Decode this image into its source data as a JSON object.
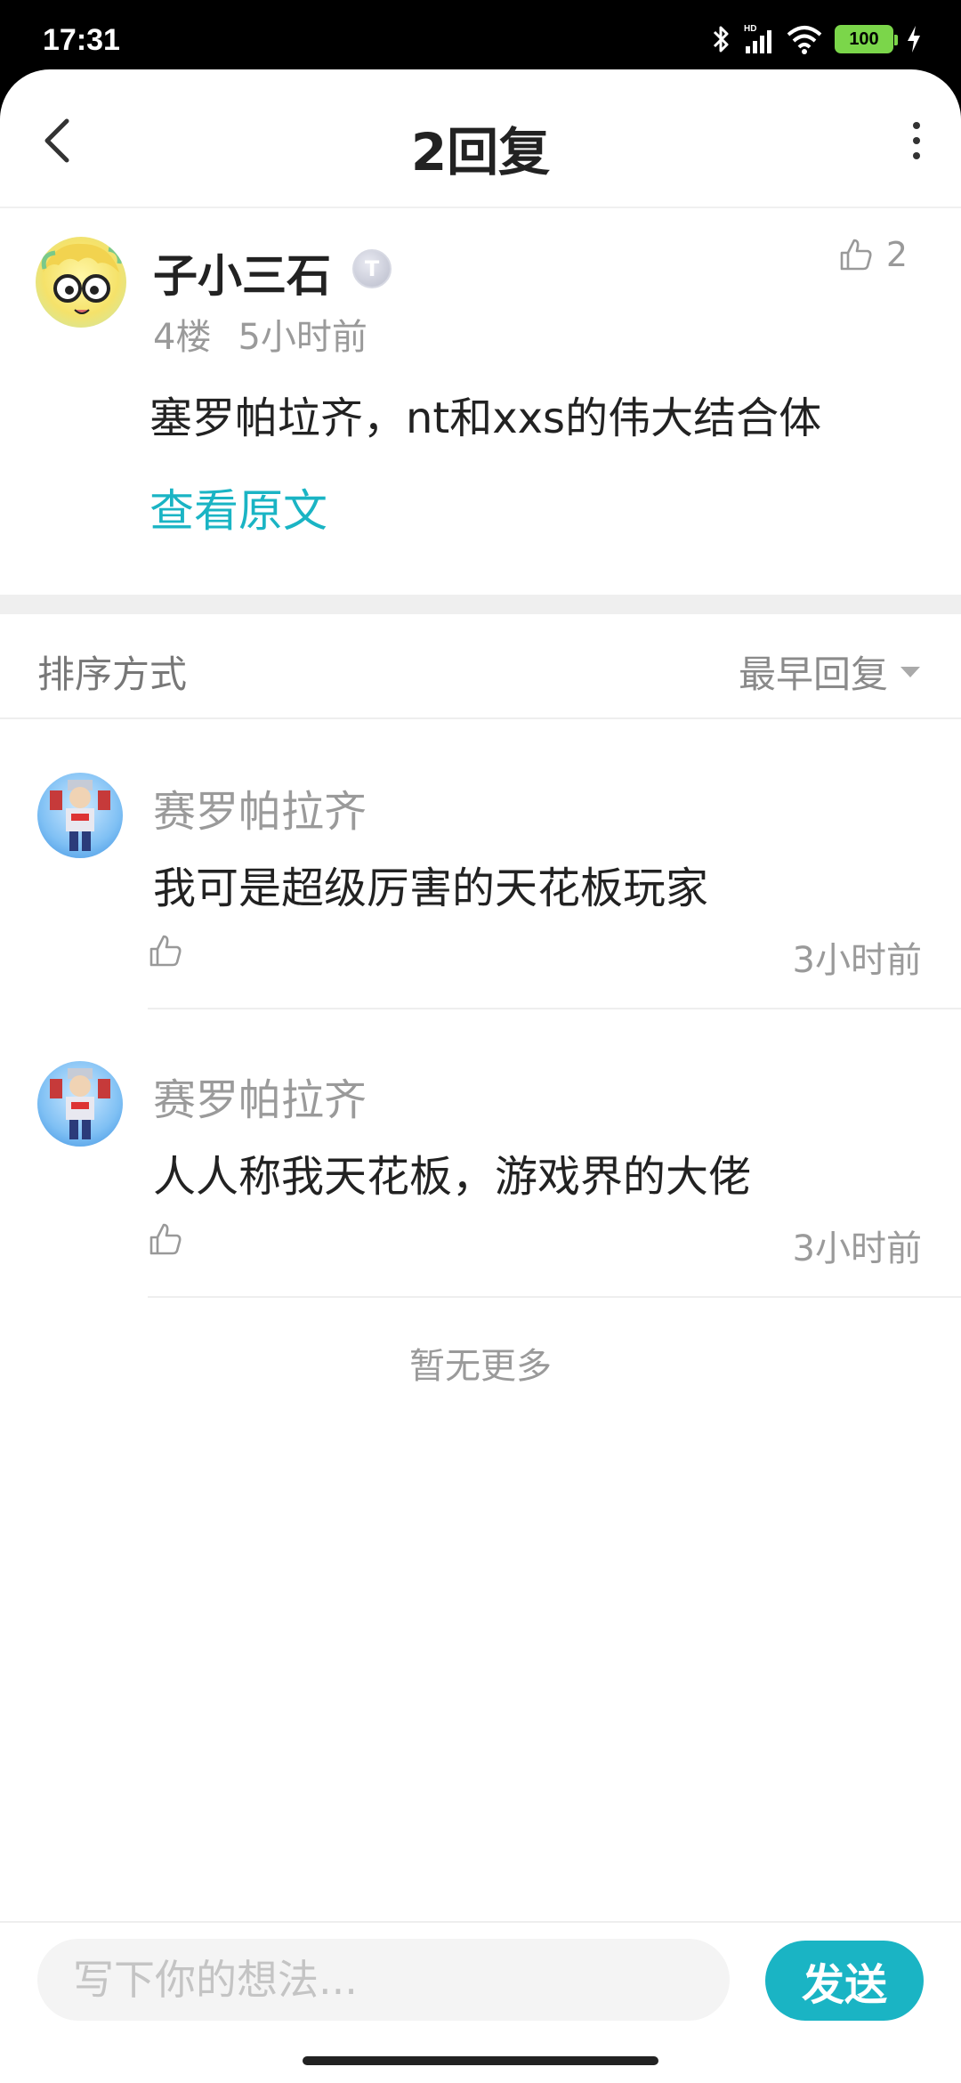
{
  "status_bar": {
    "time": "17:31",
    "battery": "100",
    "icons": [
      "bluetooth-icon",
      "signal-icon",
      "wifi-icon",
      "battery-icon",
      "charging-icon"
    ]
  },
  "header": {
    "title": "2回复",
    "back_icon": "chevron-left-icon",
    "more_icon": "more-vertical-icon"
  },
  "main_comment": {
    "author": "子小三石",
    "badge": "T",
    "likes": "2",
    "floor": "4楼",
    "time": "5小时前",
    "text": "塞罗帕垃齐，nt和xxs的伟大结合体",
    "view_original": "查看原文"
  },
  "sort": {
    "label": "排序方式",
    "selected": "最早回复"
  },
  "replies": [
    {
      "author": "赛罗帕拉齐",
      "text": "我可是超级厉害的天花板玩家",
      "time": "3小时前"
    },
    {
      "author": "赛罗帕拉齐",
      "text": "人人称我天花板，游戏界的大佬",
      "time": "3小时前"
    }
  ],
  "no_more": "暂无更多",
  "composer": {
    "placeholder": "写下你的想法...",
    "send_label": "发送"
  },
  "colors": {
    "accent": "#1ab4c4",
    "muted": "#9a9a9a"
  }
}
